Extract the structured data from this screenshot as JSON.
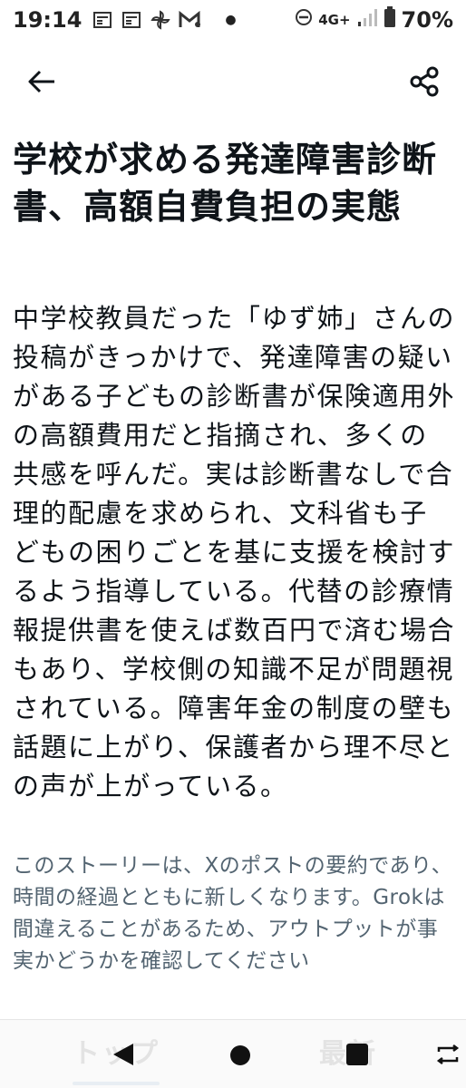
{
  "status_bar": {
    "time": "19:14",
    "network": "4G+",
    "battery": "70%"
  },
  "article": {
    "title": "学校が求める発達障害診断書、高額自費負担の実態",
    "body": "中学校教員だった「ゆず姉」さんの投稿がきっかけで、発達障害の疑いがある子どもの診断書が保険適用外の高額費用だと指摘され、多くの共感を呼んだ。実は診断書なしで合理的配慮を求められ、文科省も子どもの困りごとを基に支援を検討するよう指導している。代替の診療情報提供書を使えば数百円で済む場合もあり、学校側の知識不足が問題視されている。障害年金の制度の壁も話題に上がり、保護者から理不尽との声が上がっている。",
    "disclaimer": "このストーリーは、Xのポストの要約であり、時間の経過とともに新しくなります。Grokは間違えることがあるため、アウトプットが事実かどうかを確認してください"
  },
  "bottom_tabs": {
    "top_label": "トップ",
    "latest_label": "最新"
  },
  "icons": {
    "back": "arrow-left-icon",
    "share": "share-icon"
  }
}
